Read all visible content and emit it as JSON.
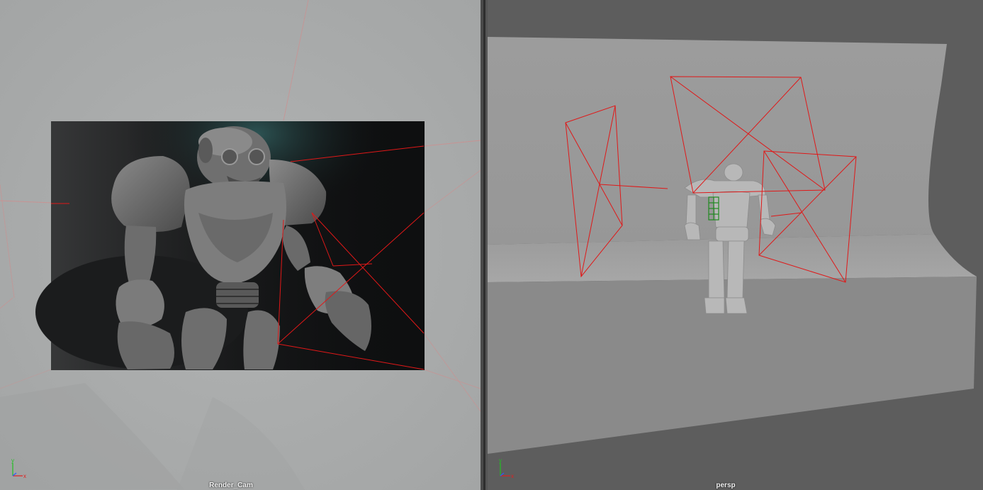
{
  "viewports": {
    "left": {
      "camera_name": "Render_Cam"
    },
    "right": {
      "camera_name": "persp"
    }
  },
  "axis_gizmo": {
    "x": "x",
    "y": "y",
    "z": "z"
  },
  "colors": {
    "viewport_left_bg": "#a9abab",
    "viewport_right_bg": "#5d5d5d",
    "backdrop_wall": "#9a9a9a",
    "backdrop_floor": "#8a8a8a",
    "light_wireframe": "#e01818",
    "selected_wireframe": "#1f8a1f",
    "render_frame_bg": "#0e0f10",
    "robot_gray": "#7c7c7c"
  },
  "icons": [
    "axis-gizmo-icon",
    "axis-gizmo-icon"
  ]
}
